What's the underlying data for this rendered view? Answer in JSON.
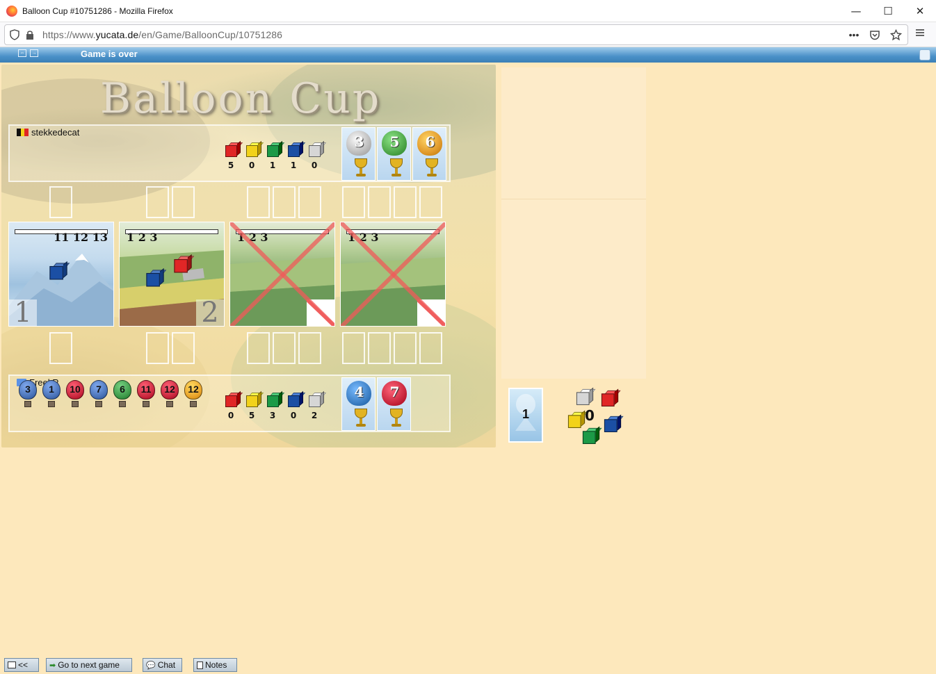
{
  "window": {
    "title": "Balloon Cup #10751286 - Mozilla Firefox",
    "controls": {
      "minimize": "—",
      "maximize": "☐",
      "close": "✕"
    }
  },
  "browser": {
    "url_prefix": "https://www.",
    "url_domain": "yucata.de",
    "url_path": "/en/Game/BalloonCup/10751286"
  },
  "gamebar": {
    "status": "Game is over"
  },
  "board": {
    "logo": "Balloon Cup",
    "players": [
      {
        "name": "stekkedecat",
        "flag": "belgium",
        "cubes": [
          {
            "color": "#e02626",
            "count": "5"
          },
          {
            "color": "#f2d21a",
            "count": "0"
          },
          {
            "color": "#1c9a47",
            "count": "1"
          },
          {
            "color": "#1b4fa4",
            "count": "1"
          },
          {
            "color": "#d6d6d6",
            "count": "0"
          }
        ],
        "trophies": [
          {
            "number": "3",
            "color": "#bdbdbd"
          },
          {
            "number": "5",
            "color": "#4fa74a"
          },
          {
            "number": "6",
            "color": "#e19a2b"
          }
        ]
      },
      {
        "name": "FreekR",
        "flag": "united-nations",
        "hand": [
          {
            "number": "3",
            "color": "#4a73b8"
          },
          {
            "number": "1",
            "color": "#4a73b8"
          },
          {
            "number": "10",
            "color": "#c9283e"
          },
          {
            "number": "7",
            "color": "#4a73b8"
          },
          {
            "number": "6",
            "color": "#3f9a4a"
          },
          {
            "number": "11",
            "color": "#c9283e"
          },
          {
            "number": "12",
            "color": "#c9283e"
          },
          {
            "number": "12",
            "color": "#e9a32a"
          }
        ],
        "cubes": [
          {
            "color": "#e02626",
            "count": "0"
          },
          {
            "color": "#f2d21a",
            "count": "5"
          },
          {
            "color": "#1c9a47",
            "count": "3"
          },
          {
            "color": "#1b4fa4",
            "count": "0"
          },
          {
            "color": "#d6d6d6",
            "count": "2"
          }
        ],
        "trophies": [
          {
            "number": "4",
            "color": "#3d7fc4"
          },
          {
            "number": "7",
            "color": "#c9283e"
          }
        ]
      }
    ],
    "tiles": [
      {
        "scale_left": "",
        "scale_right": "11 12 13",
        "number": "1",
        "terrain": "mountain",
        "crossed": false
      },
      {
        "scale_left": "1 2 3",
        "scale_right": "",
        "number": "2",
        "terrain": "fields",
        "crossed": false
      },
      {
        "scale_left": "1 2 3",
        "scale_right": "",
        "number": "",
        "terrain": "plains",
        "crossed": true
      },
      {
        "scale_left": "1 2 3",
        "scale_right": "",
        "number": "",
        "terrain": "plains",
        "crossed": true
      }
    ]
  },
  "supply": {
    "deck_count": "1",
    "cube_pool_count": "0"
  },
  "footer": {
    "back_label": "<<",
    "next_game_label": "Go to next game",
    "chat_label": "Chat",
    "notes_label": "Notes"
  }
}
